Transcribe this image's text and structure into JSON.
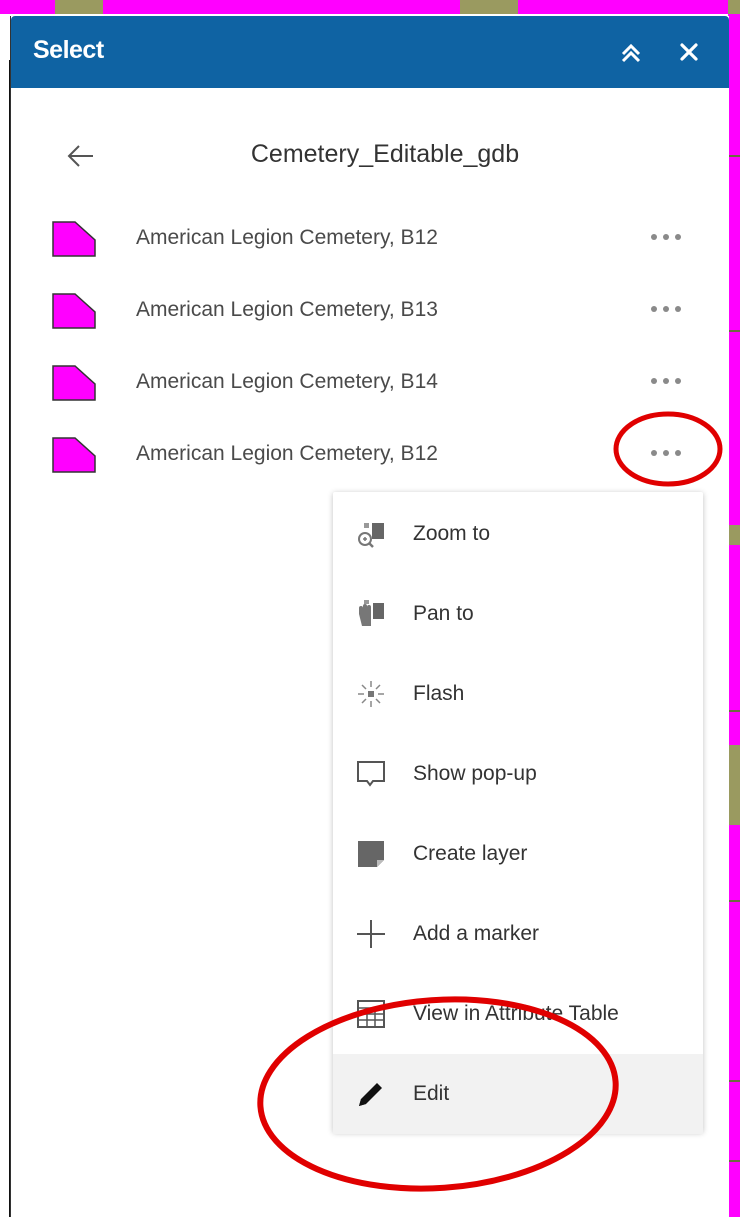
{
  "panel": {
    "title": "Select",
    "layer_name": "Cemetery_Editable_gdb",
    "feature_color": "#ff00ff",
    "header_color": "#0f63a3"
  },
  "features": [
    {
      "label": "American Legion Cemetery, B12"
    },
    {
      "label": "American Legion Cemetery, B13"
    },
    {
      "label": "American Legion Cemetery, B14"
    },
    {
      "label": "American Legion Cemetery, B12"
    }
  ],
  "context_menu": {
    "items": [
      {
        "label": "Zoom to",
        "icon": "zoom-to-icon"
      },
      {
        "label": "Pan to",
        "icon": "pan-to-icon"
      },
      {
        "label": "Flash",
        "icon": "flash-icon"
      },
      {
        "label": "Show pop-up",
        "icon": "popup-icon"
      },
      {
        "label": "Create layer",
        "icon": "create-layer-icon"
      },
      {
        "label": "Add a marker",
        "icon": "plus-icon"
      },
      {
        "label": "View in Attribute Table",
        "icon": "table-icon"
      },
      {
        "label": "Edit",
        "icon": "pencil-icon"
      }
    ],
    "highlighted_item": "Edit"
  },
  "annotations": {
    "color": "#e00000"
  }
}
